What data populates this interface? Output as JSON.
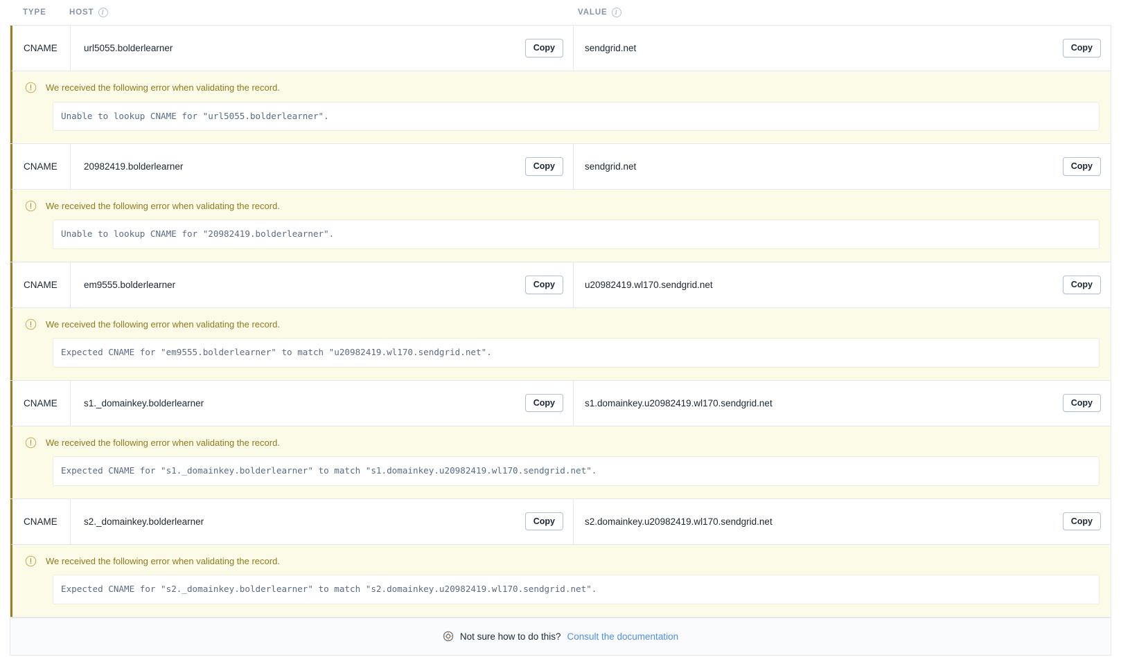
{
  "table": {
    "columns": [
      {
        "label": "TYPE",
        "has_info_icon": false,
        "icon": null
      },
      {
        "label": "HOST",
        "has_info_icon": true,
        "icon": "info-icon"
      },
      {
        "label": "VALUE",
        "has_info_icon": true,
        "icon": "info-icon"
      }
    ],
    "copy_label": "Copy",
    "warning_icon": "exclamation-circle-icon",
    "warning_message": "We received the following error when validating the record.",
    "records": [
      {
        "type": "CNAME",
        "host": "url5055.bolderlearner",
        "value": "sendgrid.net",
        "error_detail": "Unable to lookup CNAME for \"url5055.bolderlearner\"."
      },
      {
        "type": "CNAME",
        "host": "20982419.bolderlearner",
        "value": "sendgrid.net",
        "error_detail": "Unable to lookup CNAME for \"20982419.bolderlearner\"."
      },
      {
        "type": "CNAME",
        "host": "em9555.bolderlearner",
        "value": "u20982419.wl170.sendgrid.net",
        "error_detail": "Expected CNAME for \"em9555.bolderlearner\" to match \"u20982419.wl170.sendgrid.net\"."
      },
      {
        "type": "CNAME",
        "host": "s1._domainkey.bolderlearner",
        "value": "s1.domainkey.u20982419.wl170.sendgrid.net",
        "error_detail": "Expected CNAME for \"s1._domainkey.bolderlearner\" to match \"s1.domainkey.u20982419.wl170.sendgrid.net\"."
      },
      {
        "type": "CNAME",
        "host": "s2._domainkey.bolderlearner",
        "value": "s2.domainkey.u20982419.wl170.sendgrid.net",
        "error_detail": "Expected CNAME for \"s2._domainkey.bolderlearner\" to match \"s2.domainkey.u20982419.wl170.sendgrid.net\"."
      }
    ]
  },
  "footer": {
    "icon": "lifebuoy-icon",
    "text": "Not sure how to do this?",
    "link_label": "Consult the documentation"
  },
  "colors": {
    "warning_background": "#fcfbe8",
    "warning_accent": "#9c7f1f",
    "warning_text": "#8f7a1e",
    "link": "#4f8eea",
    "border": "#e3e8ee",
    "header_text": "#8494a7",
    "code_text": "#5a6b85"
  }
}
